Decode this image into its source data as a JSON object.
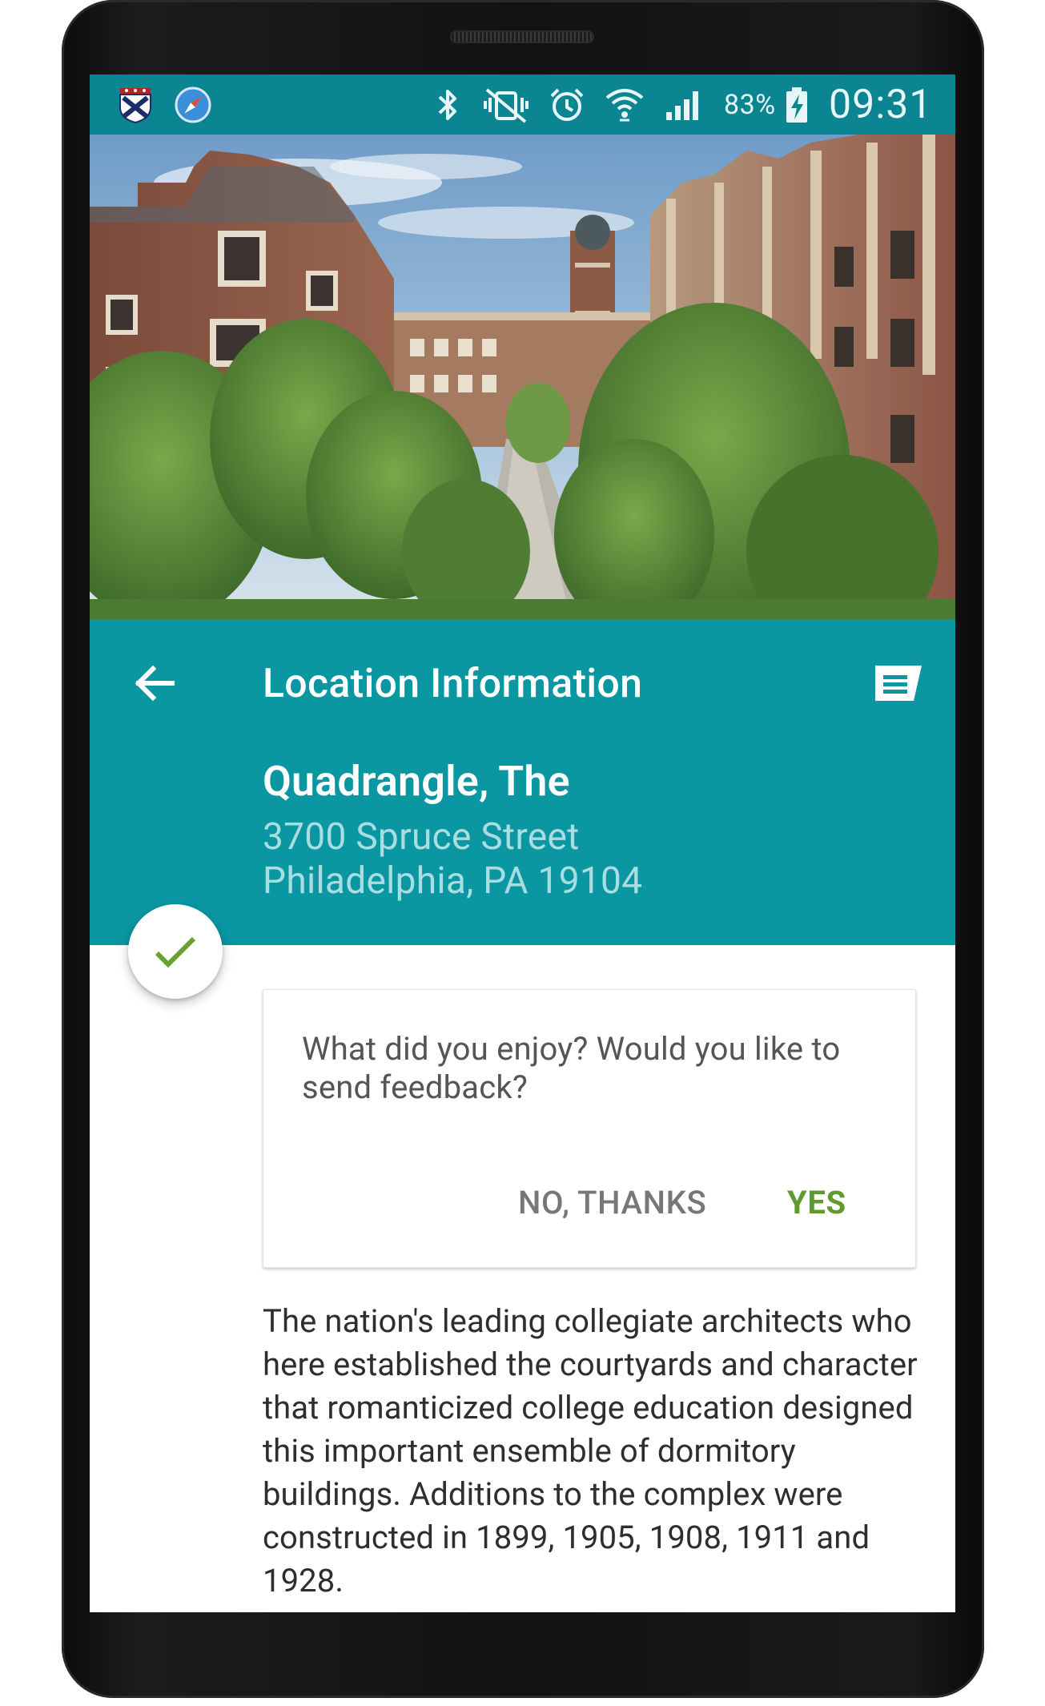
{
  "status_bar": {
    "icons": [
      "university-crest-icon",
      "compass-icon",
      "bluetooth-icon",
      "vibrate-off-icon",
      "alarm-icon",
      "wifi-icon",
      "signal-icon",
      "battery-charging-icon"
    ],
    "battery_percent": "83%",
    "time": "09:31"
  },
  "hero": {
    "image_subject": "campus-quadrangle-photo"
  },
  "header": {
    "title": "Location Information",
    "back_icon": "arrow-back-icon",
    "action_icon": "feedback-icon"
  },
  "location": {
    "name": "Quadrangle, The",
    "address_line1": "3700 Spruce Street",
    "address_line2": "Philadelphia, PA 19104"
  },
  "visited_badge": {
    "icon": "check-icon"
  },
  "feedback_card": {
    "question": "What did you enjoy? Would you like to send feedback?",
    "no_label": "NO, THANKS",
    "yes_label": "YES"
  },
  "description": "The nation's leading collegiate architects who here established the courtyards and character that romanticized college education designed this important ensemble of dormitory buildings. Additions to the complex were constructed in 1899, 1905, 1908, 1911 and 1928.",
  "colors": {
    "status_bar": "#0b8591",
    "header": "#0a97a2",
    "address": "#a9dde2",
    "accent_green": "#5e9b2f"
  }
}
